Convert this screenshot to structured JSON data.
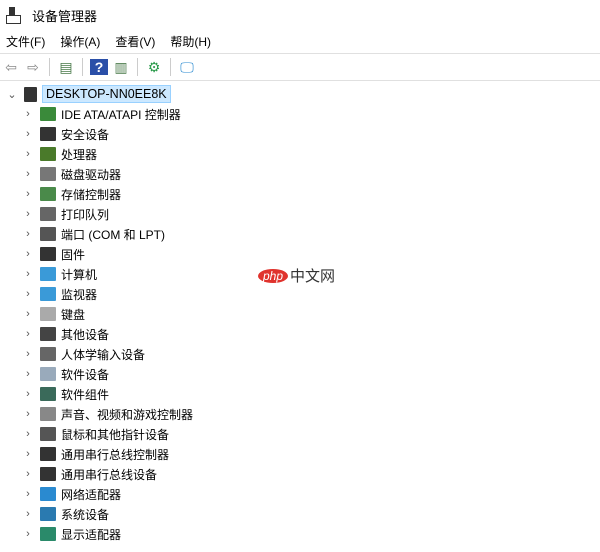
{
  "window": {
    "title": "设备管理器"
  },
  "menu": [
    "文件(F)",
    "操作(A)",
    "查看(V)",
    "帮助(H)"
  ],
  "toolbar": [
    {
      "name": "back-icon",
      "glyph": "⇦",
      "color": "#888"
    },
    {
      "name": "forward-icon",
      "glyph": "⇨",
      "color": "#888"
    },
    {
      "sep": true
    },
    {
      "name": "show-hide-console-tree-icon",
      "glyph": "▤",
      "color": "#4a7a4a"
    },
    {
      "sep": true
    },
    {
      "name": "help-icon",
      "glyph": "?",
      "color": "#fff",
      "bg": "#2a4fa8"
    },
    {
      "name": "properties-icon",
      "glyph": "▥",
      "color": "#4a7a4a"
    },
    {
      "sep": true
    },
    {
      "name": "update-driver-icon",
      "glyph": "⚙",
      "color": "#2a9a4a"
    },
    {
      "sep": true
    },
    {
      "name": "scan-hardware-icon",
      "glyph": "🖵",
      "color": "#2a8ad0"
    }
  ],
  "tree": {
    "root": "DESKTOP-NN0EE8K",
    "items": [
      {
        "label": "IDE ATA/ATAPI 控制器",
        "color": "#3a8a3a"
      },
      {
        "label": "安全设备",
        "color": "#333"
      },
      {
        "label": "处理器",
        "color": "#4a7a2a"
      },
      {
        "label": "磁盘驱动器",
        "color": "#777"
      },
      {
        "label": "存储控制器",
        "color": "#4a8a4a"
      },
      {
        "label": "打印队列",
        "color": "#666"
      },
      {
        "label": "端口 (COM 和 LPT)",
        "color": "#555"
      },
      {
        "label": "固件",
        "color": "#333"
      },
      {
        "label": "计算机",
        "color": "#3a9ad8"
      },
      {
        "label": "监视器",
        "color": "#3a9ad8"
      },
      {
        "label": "键盘",
        "color": "#aaa"
      },
      {
        "label": "其他设备",
        "color": "#444"
      },
      {
        "label": "人体学输入设备",
        "color": "#666"
      },
      {
        "label": "软件设备",
        "color": "#9ab"
      },
      {
        "label": "软件组件",
        "color": "#3a6a5a"
      },
      {
        "label": "声音、视频和游戏控制器",
        "color": "#888"
      },
      {
        "label": "鼠标和其他指针设备",
        "color": "#555"
      },
      {
        "label": "通用串行总线控制器",
        "color": "#333"
      },
      {
        "label": "通用串行总线设备",
        "color": "#333"
      },
      {
        "label": "网络适配器",
        "color": "#2a8ad0"
      },
      {
        "label": "系统设备",
        "color": "#2a7ab0"
      },
      {
        "label": "显示适配器",
        "color": "#2a8a6a"
      }
    ]
  },
  "watermark": {
    "logo": "php",
    "text": "中文网"
  }
}
